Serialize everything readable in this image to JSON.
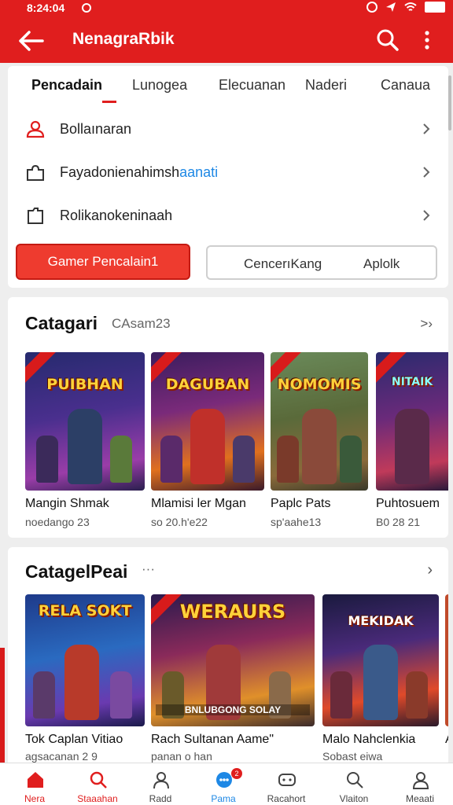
{
  "status_bar": {
    "time": "8:24:04"
  },
  "app_bar": {
    "title": "NenagraRbik"
  },
  "tabs": [
    {
      "label": "Pencadain",
      "active": true
    },
    {
      "label": "Lunogea"
    },
    {
      "label": "Elecuanan"
    },
    {
      "label": "Naderi"
    },
    {
      "label": "Canaua"
    }
  ],
  "menu_rows": [
    {
      "label": "Bollaınaran",
      "icon": "user-icon"
    },
    {
      "label": "Fayadonienahimsh",
      "accent": "aanati",
      "icon": "puzzle-icon"
    },
    {
      "label": "Rolikanokeninaah",
      "icon": "folder-icon"
    }
  ],
  "buttons": {
    "primary": "Gamer Pencalain1",
    "outline_left": "CencerıKang",
    "outline_right": "Aplolk"
  },
  "section1": {
    "title": "Catagari",
    "subtitle": "CAsam23",
    "more": ">›",
    "games": [
      {
        "art_title": "PUIBHAN",
        "name": "Mangin Shmak",
        "meta": "noedango 23"
      },
      {
        "art_title": "DAGUBAN",
        "name": "Mlamisi ler Mgan",
        "meta": "so 20.h'e22"
      },
      {
        "art_title": "NOMOMIS",
        "name": "Paplc Pats",
        "meta": "sp'aahe13"
      },
      {
        "art_title": "NITAIK",
        "name": "Puhtosuem",
        "meta": "B0 28 21"
      }
    ]
  },
  "section2": {
    "title": "CatagelPeai",
    "dots": "···",
    "more": "›",
    "games": [
      {
        "art_title": "RELA SOKT",
        "name": "Tok Caplan Vitiao",
        "meta": "agsacanan 2 9"
      },
      {
        "art_title": "WERAURS",
        "banner": "BNLUBGONG SOLAY",
        "name": "Rach Sultanan Aame\"",
        "meta": "panan o han"
      },
      {
        "art_title": "MEKIDAK",
        "name": "Malo Nahclenkia",
        "meta": "Sobast eiwa"
      },
      {
        "art_title": "",
        "name": "A",
        "meta": ""
      }
    ]
  },
  "bottom_nav": [
    {
      "label": "Nera",
      "icon": "home-icon",
      "active": true
    },
    {
      "label": "Staaahan",
      "icon": "search-icon"
    },
    {
      "label": "Radd",
      "icon": "person-icon"
    },
    {
      "label": "Pama",
      "icon": "chat-icon",
      "badge": "2"
    },
    {
      "label": "Racahort",
      "icon": "gamepad-icon"
    },
    {
      "label": "Vlaiton",
      "icon": "magnifier-icon"
    },
    {
      "label": "Meaati",
      "icon": "profile-icon"
    }
  ],
  "colors": {
    "brand_red": "#e01e1e",
    "accent_blue": "#1e88e5"
  }
}
